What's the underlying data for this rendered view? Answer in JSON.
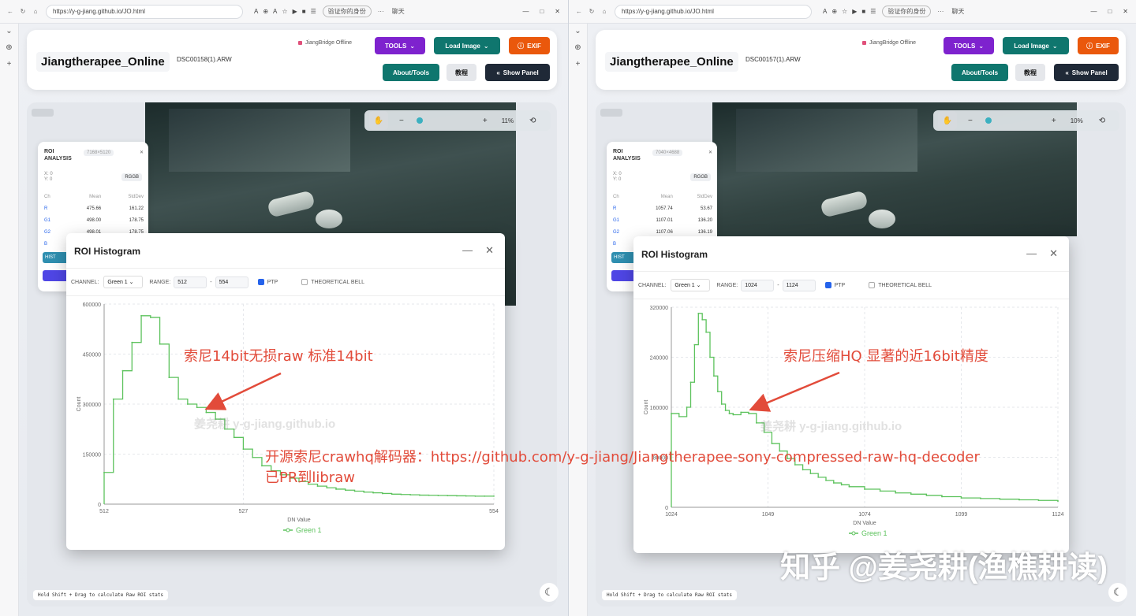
{
  "left": {
    "url": "https://y-g-jiang.github.io/JO.html",
    "profile": "验证你的身份",
    "chat": "聊天",
    "app_title": "Jiangtherapee_Online",
    "filename": "DSC00158(1).ARW",
    "offline": "JiangBridge Offline",
    "buttons": {
      "tools": "TOOLS",
      "load": "Load Image",
      "exif": "EXIF",
      "about": "About/Tools",
      "tutorial": "教程",
      "show_panel": "Show Panel"
    },
    "zoom": "11%",
    "roi": {
      "title": "ROI ANALYSIS",
      "size": "7168×5120",
      "xy": "X: 0\nY: 0",
      "pattern": "RGGB",
      "headers": [
        "Ch",
        "Mean",
        "StdDev"
      ],
      "rows": [
        [
          "R",
          "475.66",
          "161.22"
        ],
        [
          "G1",
          "498.00",
          "178.75"
        ],
        [
          "G2",
          "498.01",
          "178.75"
        ],
        [
          "B",
          "",
          ""
        ]
      ],
      "hist_btn": "HIST"
    },
    "histogram": {
      "title": "ROI Histogram",
      "channel_label": "CHANNEL:",
      "channel": "Green 1",
      "range_label": "RANGE:",
      "range_min": "512",
      "range_max": "554",
      "ptp": "PTP",
      "bell": "THEORETICAL BELL"
    },
    "footer": "Hold Shift + Drag to calculate Raw ROI stats",
    "annotation": "索尼14bit无损raw 标准14bit"
  },
  "right": {
    "url": "https://y-g-jiang.github.io/JO.html",
    "profile": "验证你的身份",
    "chat": "聊天",
    "app_title": "Jiangtherapee_Online",
    "filename": "DSC00157(1).ARW",
    "offline": "JiangBridge Offline",
    "buttons": {
      "tools": "TOOLS",
      "load": "Load Image",
      "exif": "EXIF",
      "about": "About/Tools",
      "tutorial": "教程",
      "show_panel": "Show Panel"
    },
    "zoom": "10%",
    "roi": {
      "title": "ROI ANALYSIS",
      "size": "7040×4688",
      "xy": "X: 0\nY: 0",
      "pattern": "RGGB",
      "headers": [
        "Ch",
        "Mean",
        "StdDev"
      ],
      "rows": [
        [
          "R",
          "1057.74",
          "53.67"
        ],
        [
          "G1",
          "1107.01",
          "136.20"
        ],
        [
          "G2",
          "1107.06",
          "136.19"
        ],
        [
          "B",
          "",
          ""
        ]
      ],
      "hist_btn": "HIST"
    },
    "histogram": {
      "title": "ROI Histogram",
      "channel_label": "CHANNEL:",
      "channel": "Green 1",
      "range_label": "RANGE:",
      "range_min": "1024",
      "range_max": "1124",
      "ptp": "PTP",
      "bell": "THEORETICAL BELL"
    },
    "footer": "Hold Shift + Drag to calculate Raw ROI stats",
    "annotation": "索尼压缩HQ 显著的近16bit精度"
  },
  "overlay": {
    "link_text": "开源索尼crawhq解码器：https://github.com/y-g-jiang/Jiangtherapee-sony-compressed-raw-hq-decoder",
    "link_text2": "已PR到libraw",
    "watermark": "姜尧耕 y-g-jiang.github.io",
    "zhihu": "知乎 @姜尧耕(渔樵耕读)"
  },
  "colors": {
    "series": "#5cc25c",
    "arrow": "#e24b3a",
    "purple": "#7e22ce",
    "teal": "#0f766e",
    "orange": "#ea580c"
  },
  "chart_data": [
    {
      "type": "line",
      "xlabel": "DN Value",
      "ylabel": "Count",
      "xlim": [
        512,
        554
      ],
      "ylim": [
        0,
        600000
      ],
      "x_ticks": [
        512,
        527,
        554
      ],
      "y_ticks": [
        0,
        150000,
        300000,
        450000,
        600000
      ],
      "series": [
        {
          "name": "Green 1",
          "x": [
            512,
            513,
            514,
            515,
            516,
            517,
            518,
            519,
            520,
            521,
            522,
            523,
            524,
            525,
            526,
            527,
            528,
            529,
            530,
            531,
            532,
            533,
            534,
            535,
            536,
            537,
            538,
            539,
            540,
            541,
            542,
            543,
            544,
            545,
            546,
            547,
            548,
            549,
            550,
            551,
            552,
            553,
            554
          ],
          "values": [
            95000,
            315000,
            400000,
            485000,
            565000,
            560000,
            480000,
            380000,
            315000,
            300000,
            290000,
            275000,
            255000,
            225000,
            200000,
            165000,
            140000,
            115000,
            100000,
            88000,
            78000,
            68000,
            60000,
            54000,
            49000,
            45000,
            42000,
            39000,
            36000,
            34000,
            32000,
            30000,
            29000,
            28000,
            27000,
            26500,
            26000,
            25500,
            25000,
            24500,
            24000,
            24000,
            24000
          ]
        }
      ]
    },
    {
      "type": "line",
      "xlabel": "DN Value",
      "ylabel": "Count",
      "xlim": [
        1024,
        1124
      ],
      "ylim": [
        0,
        320000
      ],
      "x_ticks": [
        1024,
        1049,
        1074,
        1099,
        1124
      ],
      "y_ticks": [
        0,
        80000,
        160000,
        240000,
        320000
      ],
      "series": [
        {
          "name": "Green 1",
          "x": [
            1024,
            1026,
            1028,
            1029,
            1030,
            1031,
            1032,
            1033,
            1034,
            1035,
            1036,
            1037,
            1038,
            1039,
            1040,
            1042,
            1044,
            1046,
            1048,
            1050,
            1052,
            1054,
            1056,
            1058,
            1060,
            1062,
            1064,
            1066,
            1068,
            1070,
            1074,
            1078,
            1082,
            1086,
            1090,
            1094,
            1099,
            1104,
            1109,
            1114,
            1119,
            1124
          ],
          "values": [
            150000,
            145000,
            160000,
            200000,
            260000,
            310000,
            300000,
            280000,
            240000,
            210000,
            185000,
            165000,
            155000,
            150000,
            148000,
            152000,
            150000,
            135000,
            120000,
            102000,
            90000,
            78000,
            68000,
            60000,
            54000,
            48000,
            43000,
            39000,
            36000,
            33000,
            29000,
            26000,
            23000,
            21000,
            19000,
            17000,
            15000,
            14000,
            13000,
            12000,
            11000,
            10000
          ]
        }
      ]
    }
  ]
}
